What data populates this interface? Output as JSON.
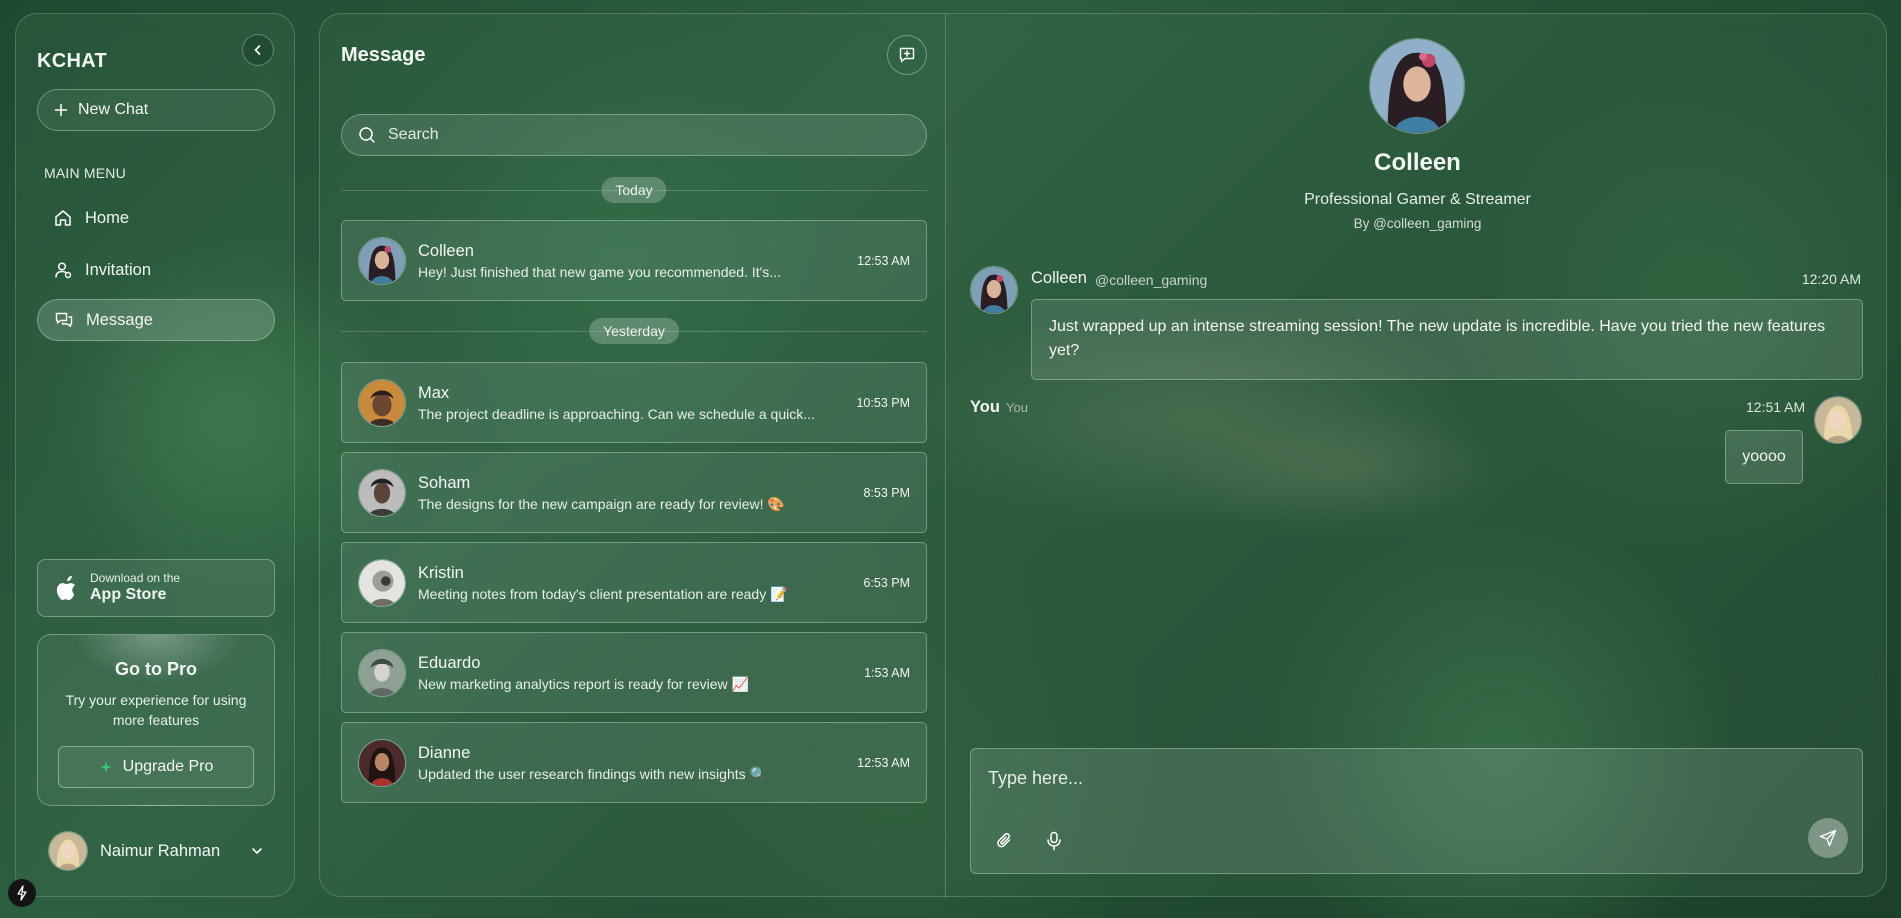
{
  "sidebar": {
    "brand": "KCHAT",
    "new_chat_label": "New Chat",
    "menu_label": "MAIN MENU",
    "items": [
      {
        "label": "Home",
        "icon": "home-icon"
      },
      {
        "label": "Invitation",
        "icon": "user-plus-icon"
      },
      {
        "label": "Message",
        "icon": "messages-icon",
        "active": true
      }
    ],
    "app_store": {
      "small": "Download on the",
      "big": "App Store"
    },
    "pro": {
      "title": "Go to Pro",
      "subtitle": "Try your experience for using more features",
      "button_label": "Upgrade Pro"
    },
    "user": {
      "name": "Naimur Rahman"
    }
  },
  "list": {
    "title": "Message",
    "search_placeholder": "Search",
    "sections": {
      "today": "Today",
      "yesterday": "Yesterday"
    },
    "chats": [
      {
        "name": "Colleen",
        "preview": "Hey! Just finished that new game you recommended. It's...",
        "time": "12:53 AM"
      },
      {
        "name": "Max",
        "preview": "The project deadline is approaching. Can we schedule a quick...",
        "time": "10:53 PM"
      },
      {
        "name": "Soham",
        "preview": "The designs for the new campaign are ready for review! 🎨",
        "time": "8:53 PM"
      },
      {
        "name": "Kristin",
        "preview": "Meeting notes from today's client presentation are ready 📝",
        "time": "6:53 PM"
      },
      {
        "name": "Eduardo",
        "preview": "New marketing analytics report is ready for review 📈",
        "time": "1:53 AM"
      },
      {
        "name": "Dianne",
        "preview": "Updated the user research findings with new insights 🔍",
        "time": "12:53 AM"
      }
    ]
  },
  "conversation": {
    "profile": {
      "name": "Colleen",
      "bio": "Professional Gamer & Streamer",
      "handle": "By @colleen_gaming"
    },
    "incoming": {
      "name": "Colleen",
      "handle": "@colleen_gaming",
      "time": "12:20 AM",
      "text": "Just wrapped up an intense streaming session! The new update is incredible. Have you tried the new features yet?"
    },
    "outgoing": {
      "name": "You",
      "handle": "You",
      "time": "12:51 AM",
      "text": "yoooo"
    },
    "composer_placeholder": "Type here..."
  },
  "colors": {
    "accent_green": "#2ecc71",
    "panel_glass": "#3c6e50"
  }
}
